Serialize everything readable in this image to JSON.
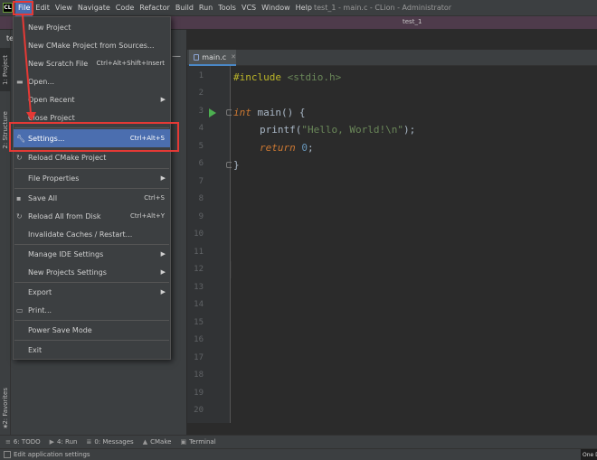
{
  "menubar": {
    "app_icon": "CL",
    "items": [
      "File",
      "Edit",
      "View",
      "Navigate",
      "Code",
      "Refactor",
      "Build",
      "Run",
      "Tools",
      "VCS",
      "Window",
      "Help"
    ],
    "window_title": "test_1 - main.c - CLion - Administrator"
  },
  "navbar": {
    "project": "test_1"
  },
  "left_strip": {
    "tabs": [
      "1: Project",
      "2: Structure",
      "2: Favorites"
    ]
  },
  "project_panel": {
    "header": "te"
  },
  "editor": {
    "tab_label": "main.c",
    "line_numbers": [
      "1",
      "2",
      "3",
      "4",
      "5",
      "6",
      "7",
      "8",
      "9",
      "10",
      "11",
      "12",
      "13",
      "14",
      "15",
      "16",
      "17",
      "18",
      "19",
      "20"
    ],
    "code": {
      "l1_pp": "#include",
      "l1_rest": " <stdio.h>",
      "l3_kw": "int",
      "l3_rest": " main() {",
      "l4_fn": "printf(",
      "l4_str": "\"Hello, World!\\n\"",
      "l4_end": ");",
      "l5_kw": "return",
      "l5_num": " 0",
      "l5_end": ";",
      "l6": "}"
    }
  },
  "file_menu": {
    "items": [
      {
        "label": "New Project",
        "icon": "",
        "shortcut": "",
        "arrow": false
      },
      {
        "label": "New CMake Project from Sources...",
        "icon": "",
        "shortcut": "",
        "arrow": false
      },
      {
        "label": "New Scratch File",
        "icon": "",
        "shortcut": "Ctrl+Alt+Shift+Insert",
        "arrow": false
      },
      {
        "label": "Open...",
        "icon": "folder-icon",
        "shortcut": "",
        "arrow": false
      },
      {
        "label": "Open Recent",
        "icon": "",
        "shortcut": "",
        "arrow": true
      },
      {
        "label": "Close Project",
        "icon": "",
        "shortcut": "",
        "arrow": false
      },
      {
        "label": "Settings...",
        "icon": "wrench-icon",
        "shortcut": "Ctrl+Alt+S",
        "arrow": false
      },
      {
        "label": "Reload CMake Project",
        "icon": "reload-icon",
        "shortcut": "",
        "arrow": false
      },
      {
        "label": "File Properties",
        "icon": "",
        "shortcut": "",
        "arrow": true
      },
      {
        "label": "Save All",
        "icon": "save-icon",
        "shortcut": "Ctrl+S",
        "arrow": false
      },
      {
        "label": "Reload All from Disk",
        "icon": "reload-icon",
        "shortcut": "Ctrl+Alt+Y",
        "arrow": false
      },
      {
        "label": "Invalidate Caches / Restart...",
        "icon": "",
        "shortcut": "",
        "arrow": false
      },
      {
        "label": "Manage IDE Settings",
        "icon": "",
        "shortcut": "",
        "arrow": true
      },
      {
        "label": "New Projects Settings",
        "icon": "",
        "shortcut": "",
        "arrow": true
      },
      {
        "label": "Export",
        "icon": "",
        "shortcut": "",
        "arrow": true
      },
      {
        "label": "Print...",
        "icon": "print-icon",
        "shortcut": "",
        "arrow": false
      },
      {
        "label": "Power Save Mode",
        "icon": "",
        "shortcut": "",
        "arrow": false
      },
      {
        "label": "Exit",
        "icon": "",
        "shortcut": "",
        "arrow": false
      }
    ]
  },
  "bottom_tools": {
    "todo": "6: TODO",
    "run": "4: Run",
    "messages": "0: Messages",
    "cmake": "CMake",
    "terminal": "Terminal"
  },
  "status": {
    "text": "Edit application settings",
    "right": "One D"
  },
  "colors": {
    "annotation": "#e53935",
    "menu_highlight": "#4b6eaf",
    "navbar": "#4e3b4b"
  }
}
